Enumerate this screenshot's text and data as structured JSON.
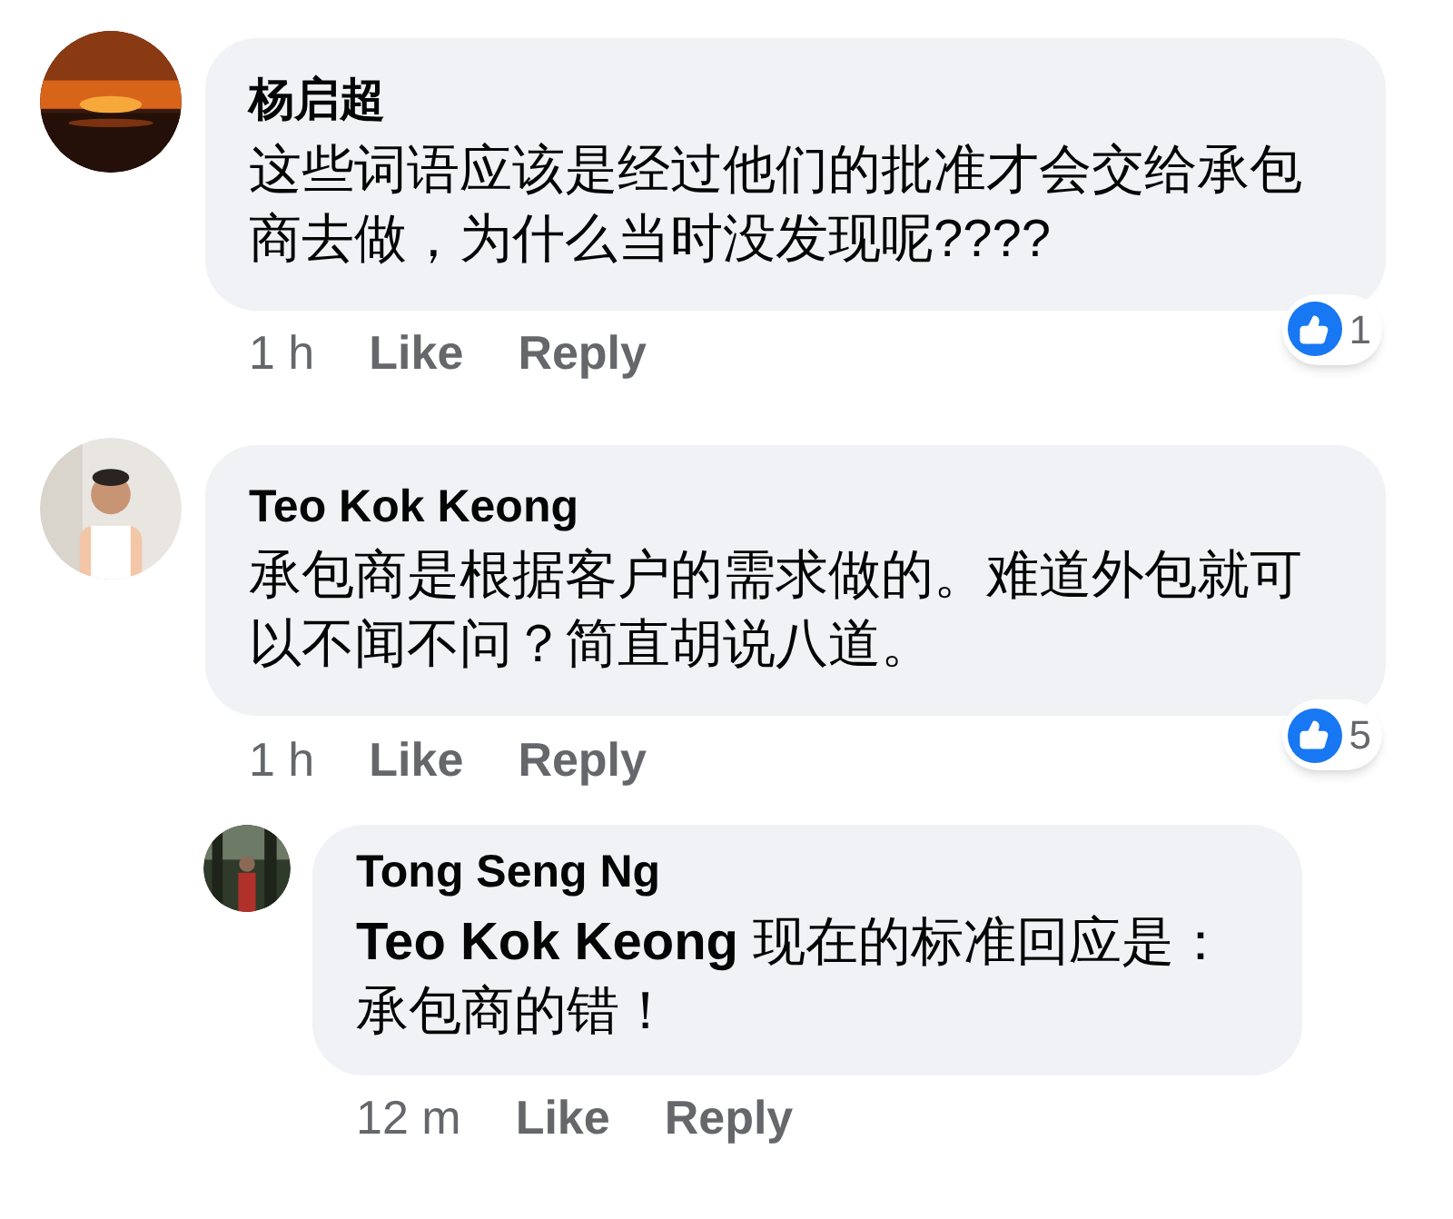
{
  "comments": [
    {
      "author": "杨启超",
      "text": "这些词语应该是经过他们的批准才会交给承包商去做，为什么当时没发现呢????",
      "time": "1 h",
      "like": "Like",
      "reply": "Reply",
      "reactions": "1"
    },
    {
      "author": "Teo Kok Keong",
      "text": "承包商是根据客户的需求做的。难道外包就可以不闻不问？简直胡说八道。",
      "time": "1 h",
      "like": "Like",
      "reply": "Reply",
      "reactions": "5",
      "replies": [
        {
          "author": "Tong Seng Ng",
          "text": "**Teo Kok Keong** 现在的标准回应是：承包商的错！",
          "time": "12 m",
          "like": "Like",
          "reply": "Reply"
        }
      ]
    }
  ]
}
